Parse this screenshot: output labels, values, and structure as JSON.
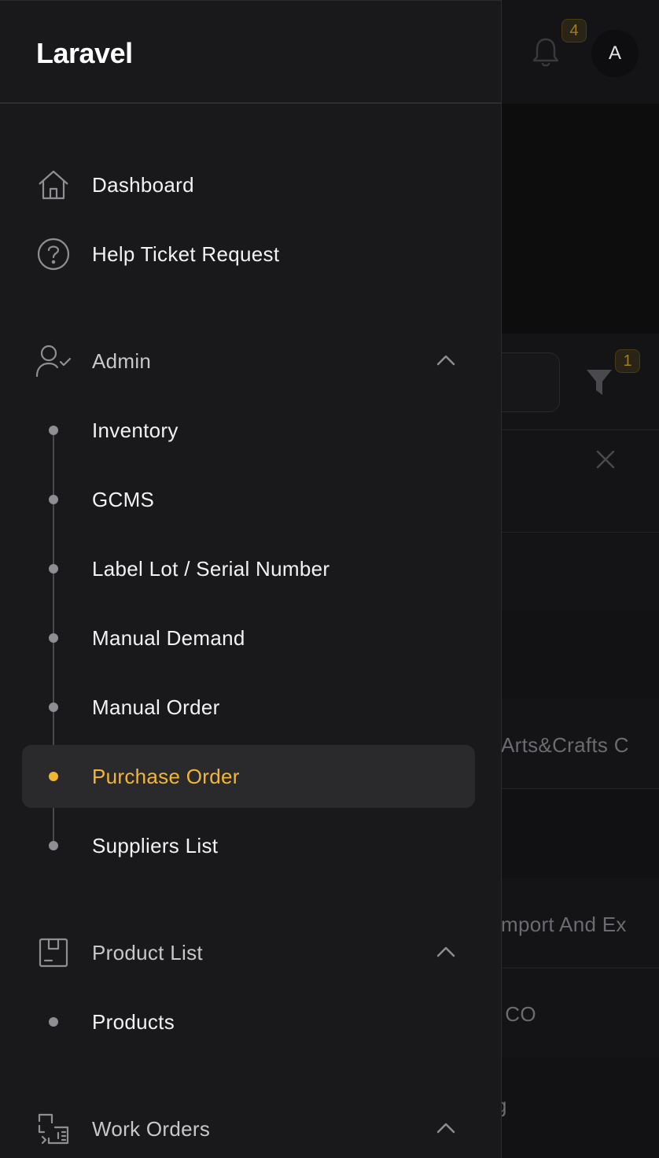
{
  "app": {
    "brand": "Laravel"
  },
  "topbar": {
    "notification_count": "4",
    "avatar_initial": "A"
  },
  "background_table": {
    "filter_count": "1",
    "cells": [
      "Arts&Crafts C",
      "mport And Ex",
      "g CO",
      "g"
    ]
  },
  "sidebar": {
    "items": [
      {
        "label": "Dashboard",
        "icon": "home-icon"
      },
      {
        "label": "Help Ticket Request",
        "icon": "help-circle-icon"
      }
    ],
    "groups": [
      {
        "label": "Admin",
        "icon": "user-check-icon",
        "expanded": true,
        "children": [
          {
            "label": "Inventory"
          },
          {
            "label": "GCMS"
          },
          {
            "label": "Label Lot / Serial Number"
          },
          {
            "label": "Manual Demand"
          },
          {
            "label": "Manual Order"
          },
          {
            "label": "Purchase Order",
            "active": true
          },
          {
            "label": "Suppliers List"
          }
        ]
      },
      {
        "label": "Product List",
        "icon": "package-icon",
        "expanded": true,
        "children": [
          {
            "label": "Products"
          }
        ]
      },
      {
        "label": "Work Orders",
        "icon": "work-order-icon",
        "expanded": true,
        "children": []
      }
    ]
  },
  "colors": {
    "accent": "#f2b632",
    "sidebar_bg": "#19191b",
    "active_bg": "#2a2a2d",
    "text": "#f2f2f2"
  }
}
